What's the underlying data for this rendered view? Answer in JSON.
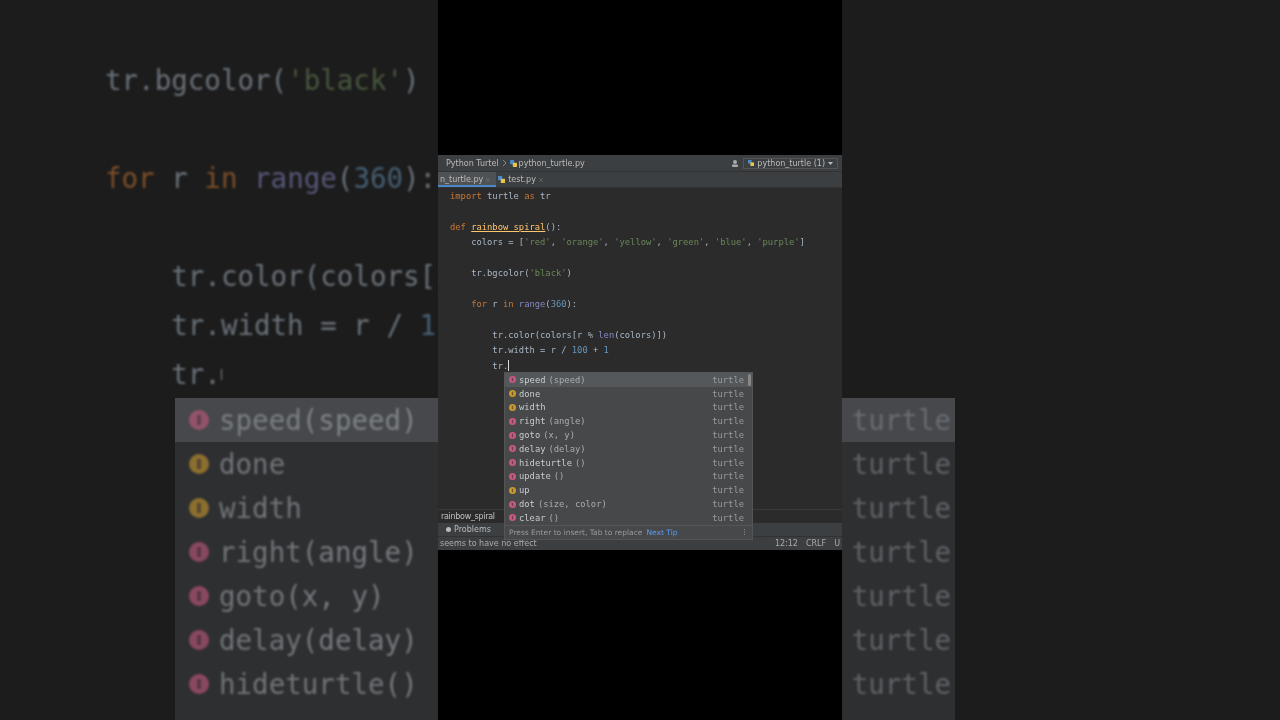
{
  "backdrop_left": {
    "blocks": [
      [
        {
          "tokens": [
            {
              "text": "tr.bgcolor(",
              "kind": "plain"
            },
            {
              "text": "'black'",
              "kind": "str"
            },
            {
              "text": ")",
              "kind": "plain"
            }
          ]
        }
      ],
      [
        {
          "tokens": [
            {
              "text": "for",
              "kind": "kw"
            },
            {
              "text": " r ",
              "kind": "plain"
            },
            {
              "text": "in",
              "kind": "kw"
            },
            {
              "text": " range",
              "kind": "builtin"
            },
            {
              "text": "(",
              "kind": "plain"
            },
            {
              "text": "360",
              "kind": "num"
            },
            {
              "text": "):",
              "kind": "plain"
            }
          ]
        }
      ],
      [
        {
          "tokens": [
            {
              "text": "    tr.color(colors[",
              "kind": "plain"
            }
          ]
        },
        {
          "tokens": [
            {
              "text": "    tr.width = r / ",
              "kind": "plain"
            },
            {
              "text": "1",
              "kind": "num"
            }
          ]
        },
        {
          "tokens": [
            {
              "text": "    tr.",
              "kind": "plain"
            }
          ],
          "caret": true
        }
      ]
    ],
    "completions": [
      {
        "name": "speed",
        "params": "(speed)",
        "kind": "function",
        "selected": true
      },
      {
        "name": "done",
        "kind": "variable",
        "selected": false
      },
      {
        "name": "width",
        "kind": "variable",
        "selected": false
      },
      {
        "name": "right",
        "params": "(angle)",
        "kind": "function",
        "selected": false
      },
      {
        "name": "goto",
        "params": "(x, y)",
        "kind": "function",
        "selected": false
      },
      {
        "name": "delay",
        "params": "(delay)",
        "kind": "function",
        "selected": false
      },
      {
        "name": "hideturtle",
        "params": "()",
        "kind": "function",
        "selected": false
      }
    ]
  },
  "backdrop_right": {
    "completions": [
      {
        "source": "turtle",
        "selected": true
      },
      {
        "source": "turtle",
        "selected": false
      },
      {
        "source": "turtle",
        "selected": false
      },
      {
        "source": "turtle",
        "selected": false
      },
      {
        "source": "turtle",
        "selected": false
      },
      {
        "source": "turtle",
        "selected": false
      },
      {
        "source": "turtle",
        "selected": false
      }
    ]
  },
  "navbar": {
    "breadcrumbs": [
      "Python Turtel",
      "python_turtle.py"
    ],
    "run_config": "python_turtle (1)"
  },
  "tabs": [
    {
      "label": "n_turtle.py",
      "selected": true
    },
    {
      "label": "test.py",
      "selected": false
    }
  ],
  "editor": {
    "blocks": [
      [
        {
          "tokens": [
            {
              "text": "import",
              "kind": "kw"
            },
            {
              "text": " turtle ",
              "kind": "plain"
            },
            {
              "text": "as",
              "kind": "kw"
            },
            {
              "text": " tr",
              "kind": "plain"
            }
          ]
        }
      ],
      [
        {
          "tokens": [
            {
              "text": "def ",
              "kind": "kw"
            },
            {
              "text": "rainbow_spiral",
              "kind": "fn"
            },
            {
              "text": "():",
              "kind": "plain"
            }
          ]
        },
        {
          "tokens": [
            {
              "text": "    colors = [",
              "kind": "plain"
            },
            {
              "text": "'red'",
              "kind": "str"
            },
            {
              "text": ", ",
              "kind": "plain"
            },
            {
              "text": "'orange'",
              "kind": "str"
            },
            {
              "text": ", ",
              "kind": "plain"
            },
            {
              "text": "'yellow'",
              "kind": "str"
            },
            {
              "text": ", ",
              "kind": "plain"
            },
            {
              "text": "'green'",
              "kind": "str"
            },
            {
              "text": ", ",
              "kind": "plain"
            },
            {
              "text": "'blue'",
              "kind": "str"
            },
            {
              "text": ", ",
              "kind": "plain"
            },
            {
              "text": "'purple'",
              "kind": "str"
            },
            {
              "text": "]",
              "kind": "plain"
            }
          ]
        }
      ],
      [
        {
          "tokens": [
            {
              "text": "    tr.bgcolor(",
              "kind": "plain"
            },
            {
              "text": "'black'",
              "kind": "str"
            },
            {
              "text": ")",
              "kind": "plain"
            }
          ]
        }
      ],
      [
        {
          "tokens": [
            {
              "text": "    for",
              "kind": "kw"
            },
            {
              "text": " r ",
              "kind": "plain"
            },
            {
              "text": "in",
              "kind": "kw"
            },
            {
              "text": " range",
              "kind": "builtin"
            },
            {
              "text": "(",
              "kind": "plain"
            },
            {
              "text": "360",
              "kind": "num"
            },
            {
              "text": "):",
              "kind": "plain"
            }
          ]
        }
      ],
      [
        {
          "tokens": [
            {
              "text": "        tr.color(colors[r % ",
              "kind": "plain"
            },
            {
              "text": "len",
              "kind": "builtin"
            },
            {
              "text": "(colors)])",
              "kind": "plain"
            }
          ]
        },
        {
          "tokens": [
            {
              "text": "        tr.width = r / ",
              "kind": "plain"
            },
            {
              "text": "100",
              "kind": "num"
            },
            {
              "text": " + ",
              "kind": "plain"
            },
            {
              "text": "1",
              "kind": "num"
            }
          ]
        },
        {
          "tokens": [
            {
              "text": "        tr.",
              "kind": "plain"
            }
          ],
          "caret": true
        }
      ]
    ]
  },
  "completion_popup": {
    "items": [
      {
        "name": "speed",
        "params": "(speed)",
        "kind": "function",
        "source": "turtle",
        "selected": true
      },
      {
        "name": "done",
        "kind": "variable",
        "source": "turtle",
        "selected": false
      },
      {
        "name": "width",
        "kind": "variable",
        "source": "turtle",
        "selected": false
      },
      {
        "name": "right",
        "params": "(angle)",
        "kind": "function",
        "source": "turtle",
        "selected": false
      },
      {
        "name": "goto",
        "params": "(x, y)",
        "kind": "function",
        "source": "turtle",
        "selected": false
      },
      {
        "name": "delay",
        "params": "(delay)",
        "kind": "function",
        "source": "turtle",
        "selected": false
      },
      {
        "name": "hideturtle",
        "params": "()",
        "kind": "function",
        "source": "turtle",
        "selected": false
      },
      {
        "name": "update",
        "params": "()",
        "kind": "function",
        "source": "turtle",
        "selected": false
      },
      {
        "name": "up",
        "kind": "variable",
        "source": "turtle",
        "selected": false
      },
      {
        "name": "dot",
        "params": "(size, color)",
        "kind": "function",
        "source": "turtle",
        "selected": false
      },
      {
        "name": "clear",
        "params": "()",
        "kind": "function",
        "source": "turtle",
        "selected": false
      }
    ],
    "hint": "Press Enter to insert, Tab to replace",
    "hint_link": "Next Tip",
    "menu": "⋮"
  },
  "breadcrumb_footer": "rainbow_spiral",
  "tool_tabs": [
    "Problems"
  ],
  "status_bar": {
    "message": "seems to have no effect",
    "position": "12:12",
    "line_ending": "CRLF",
    "encoding": "U"
  }
}
